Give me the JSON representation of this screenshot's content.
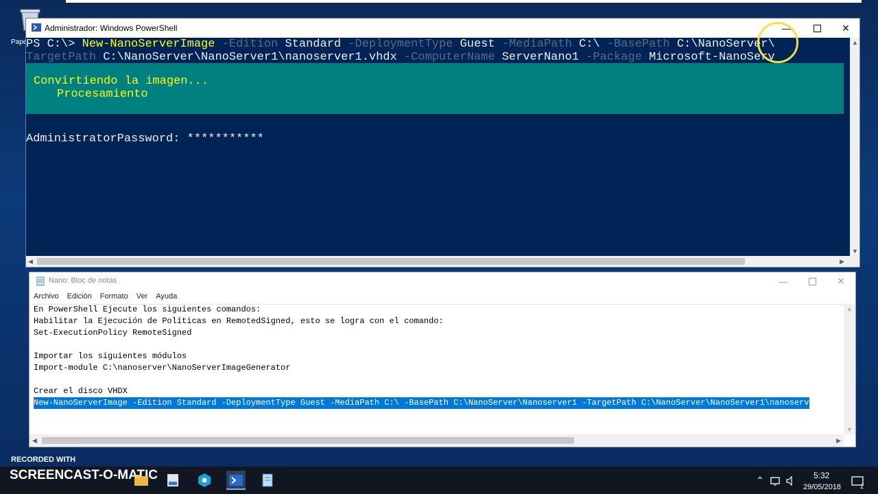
{
  "desktop": {
    "icon_label": "Papelera de reciclaje"
  },
  "powershell": {
    "title": "Administrador: Windows PowerShell",
    "line1": [
      {
        "t": "PS C:\\> ",
        "c": "w"
      },
      {
        "t": "New-NanoServerImage",
        "c": "y"
      },
      {
        "t": " -Edition",
        "c": "g"
      },
      {
        "t": " Standard",
        "c": "w"
      },
      {
        "t": " -DeploymentType",
        "c": "g"
      },
      {
        "t": " Guest",
        "c": "w"
      },
      {
        "t": " -MediaPath",
        "c": "g"
      },
      {
        "t": " C:\\",
        "c": "w"
      },
      {
        "t": " -BasePath",
        "c": "g"
      },
      {
        "t": " C:\\NanoServer\\",
        "c": "w"
      }
    ],
    "line2": [
      {
        "t": "TargetPath",
        "c": "g"
      },
      {
        "t": " C:\\NanoServer\\NanoServer1\\nanoserver1.vhdx",
        "c": "w"
      },
      {
        "t": " -ComputerName",
        "c": "g"
      },
      {
        "t": " ServerNano1",
        "c": "w"
      },
      {
        "t": " -Package",
        "c": "g"
      },
      {
        "t": " Microsoft-NanoServ",
        "c": "w"
      }
    ],
    "progress_title": "Convirtiendo la imagen...",
    "progress_status": "Procesamiento",
    "password_line": "AdministratorPassword: ***********"
  },
  "notepad": {
    "title": "Nano: Bloc de notas",
    "menu": [
      "Archivo",
      "Edición",
      "Formato",
      "Ver",
      "Ayuda"
    ],
    "lines": [
      "En PowerShell Ejecute los siguientes comandos:",
      "Habilitar la Ejecución de Políticas en RemotedSigned, esto se logra con el comando:",
      "Set-ExecutionPolicy RemoteSigned",
      "",
      "Importar los siguientes módulos",
      "Import-module C:\\nanoserver\\NanoServerImageGenerator",
      "",
      "Crear el disco VHDX"
    ],
    "selected_line": "New-NanoServerImage -Edition Standard -DeploymentType Guest -MediaPath C:\\ -BasePath C:\\NanoServer\\Nanoserver1 -TargetPath C:\\NanoServer\\NanoServer1\\nanoserv"
  },
  "watermark": {
    "recorded_with": "RECORDED WITH",
    "brand": "SCREENCAST-O-MATIC"
  },
  "taskbar": {
    "time": "5:32",
    "date": "29/05/2018",
    "notification_count": "2"
  },
  "colors": {
    "ps_background": "#012456",
    "ps_progress": "#008080",
    "ps_yellow": "#ffff00",
    "selection": "#0078d7",
    "cursor_highlight": "#f5e24a"
  }
}
